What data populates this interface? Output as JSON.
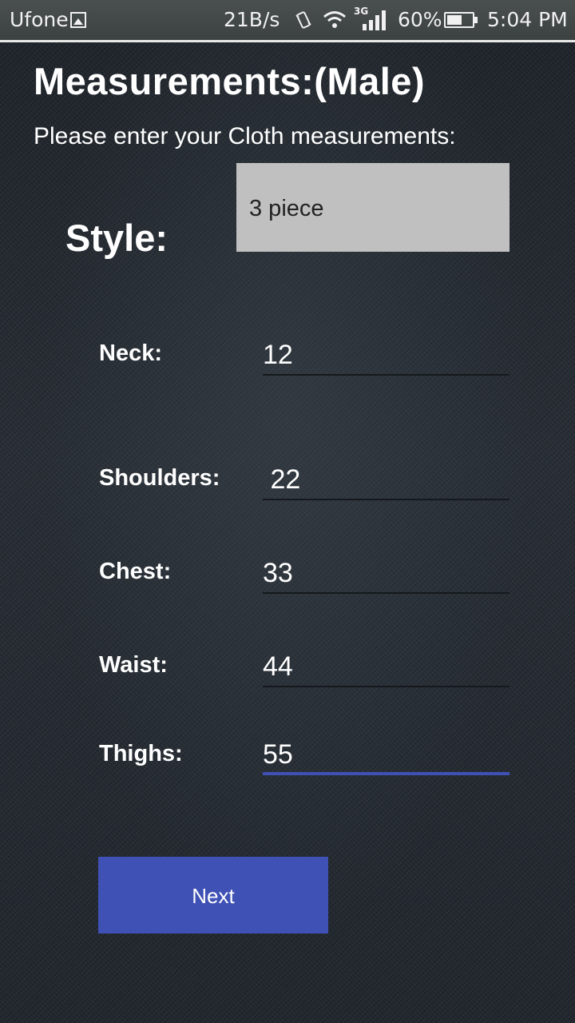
{
  "status_bar": {
    "carrier": "Ufone",
    "net_speed": "21B/s",
    "network_type": "3G",
    "battery": "60%",
    "battery_level": 0.6,
    "time": "5:04 PM"
  },
  "header": {
    "title": "Measurements:(Male)",
    "subtitle": "Please enter your Cloth measurements:"
  },
  "style": {
    "label": "Style:",
    "selected": "3 piece"
  },
  "fields": {
    "neck": {
      "label": "Neck:",
      "value": "12"
    },
    "shoulders": {
      "label": "Shoulders:",
      "value": " 22"
    },
    "chest": {
      "label": "Chest:",
      "value": "33"
    },
    "waist": {
      "label": "Waist:",
      "value": "44"
    },
    "thighs": {
      "label": "Thighs:",
      "value": "55"
    }
  },
  "actions": {
    "next_label": "Next"
  },
  "colors": {
    "accent": "#3f51b5",
    "select_bg": "#c0c0c0"
  }
}
